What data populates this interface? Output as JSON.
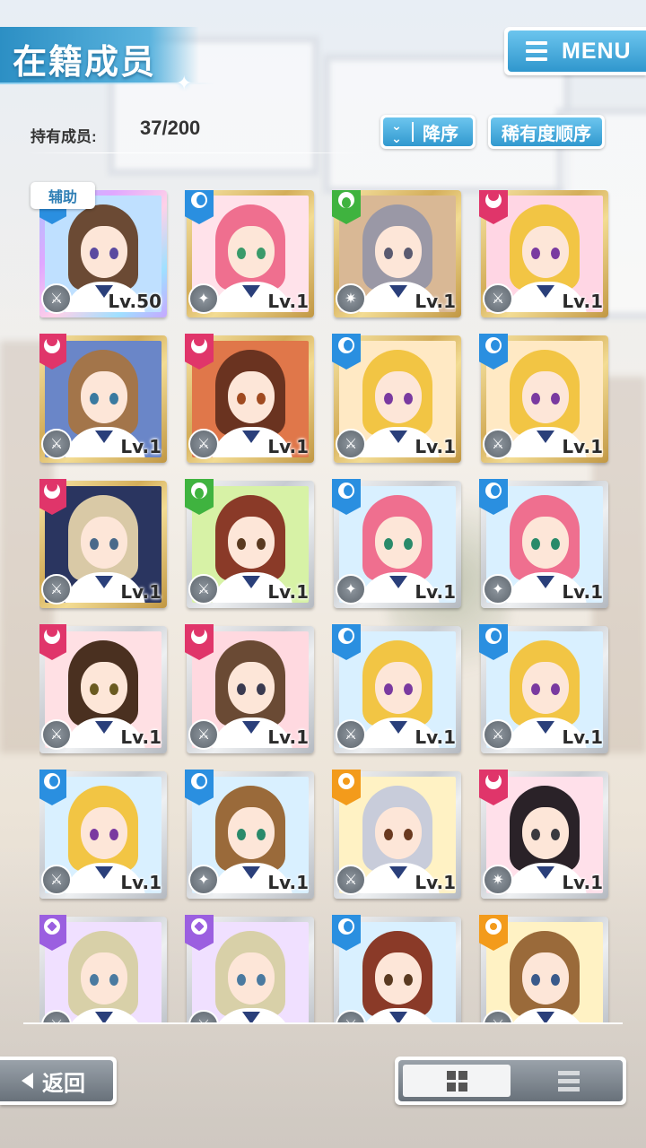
{
  "header": {
    "title": "在籍成员",
    "menu_label": "MENU"
  },
  "members": {
    "count_label": "持有成员:",
    "count_value": "37/200"
  },
  "sort": {
    "order_label": "降序",
    "mode_label": "稀有度顺序"
  },
  "support_tag": "辅助",
  "cards": [
    {
      "frame": "rainbow",
      "attr": "blue",
      "role": "⚔",
      "level": "Lv.50",
      "hair": "#6b4a34",
      "eye": "#5b4aa0",
      "bg": "#bfe0ff"
    },
    {
      "frame": "gold",
      "attr": "blue",
      "role": "✦",
      "level": "Lv.1",
      "hair": "#ef6f8f",
      "eye": "#3a9a6a",
      "bg": "#ffe2ea"
    },
    {
      "frame": "gold",
      "attr": "green",
      "role": "✷",
      "level": "Lv.1",
      "hair": "#9a98a6",
      "eye": "#5a5a70",
      "bg": "#d9b895"
    },
    {
      "frame": "gold",
      "attr": "red",
      "role": "⚔",
      "level": "Lv.1",
      "hair": "#f2c544",
      "eye": "#7a3aa0",
      "bg": "#ffd6e4"
    },
    {
      "frame": "gold",
      "attr": "red",
      "role": "⚔",
      "level": "Lv.1",
      "hair": "#a3754a",
      "eye": "#3a7aa0",
      "bg": "#6a86c8"
    },
    {
      "frame": "gold",
      "attr": "red",
      "role": "⚔",
      "level": "Lv.1",
      "hair": "#6a3320",
      "eye": "#a04a20",
      "bg": "#e0774a"
    },
    {
      "frame": "gold",
      "attr": "blue",
      "role": "⚔",
      "level": "Lv.1",
      "hair": "#f2c544",
      "eye": "#7a3aa0",
      "bg": "#ffe9c4"
    },
    {
      "frame": "gold",
      "attr": "blue",
      "role": "⚔",
      "level": "Lv.1",
      "hair": "#f2c544",
      "eye": "#7a3aa0",
      "bg": "#ffe9c4"
    },
    {
      "frame": "gold",
      "attr": "red",
      "role": "⚔",
      "level": "Lv.1",
      "hair": "#d9c9a6",
      "eye": "#4a6a8a",
      "bg": "#2a3560"
    },
    {
      "frame": "silver",
      "attr": "green",
      "role": "⚔",
      "level": "Lv.1",
      "hair": "#8a3a28",
      "eye": "#5a3a20",
      "bg": "#d7f2a6"
    },
    {
      "frame": "silver",
      "attr": "blue",
      "role": "✦",
      "level": "Lv.1",
      "hair": "#ef6f8f",
      "eye": "#2a8a6a",
      "bg": "#d9f0ff"
    },
    {
      "frame": "silver",
      "attr": "blue",
      "role": "✦",
      "level": "Lv.1",
      "hair": "#ef6f8f",
      "eye": "#2a8a6a",
      "bg": "#d9f0ff"
    },
    {
      "frame": "silver",
      "attr": "red",
      "role": "⚔",
      "level": "Lv.1",
      "hair": "#4a3020",
      "eye": "#6a5a20",
      "bg": "#ffe0e4"
    },
    {
      "frame": "silver",
      "attr": "red",
      "role": "⚔",
      "level": "Lv.1",
      "hair": "#6a4a34",
      "eye": "#3a3a50",
      "bg": "#ffd9e0"
    },
    {
      "frame": "silver",
      "attr": "blue",
      "role": "⚔",
      "level": "Lv.1",
      "hair": "#f2c544",
      "eye": "#7a3aa0",
      "bg": "#d9f0ff"
    },
    {
      "frame": "silver",
      "attr": "blue",
      "role": "⚔",
      "level": "Lv.1",
      "hair": "#f2c544",
      "eye": "#7a3aa0",
      "bg": "#d9f0ff"
    },
    {
      "frame": "silver",
      "attr": "blue",
      "role": "⚔",
      "level": "Lv.1",
      "hair": "#f2c544",
      "eye": "#7a3aa0",
      "bg": "#d9f0ff"
    },
    {
      "frame": "silver",
      "attr": "blue",
      "role": "✦",
      "level": "Lv.1",
      "hair": "#9a6a3a",
      "eye": "#2a8a6a",
      "bg": "#d9f0ff"
    },
    {
      "frame": "silver",
      "attr": "orange",
      "role": "⚔",
      "level": "Lv.1",
      "hair": "#c8ccda",
      "eye": "#6a3a20",
      "bg": "#fff2c4"
    },
    {
      "frame": "silver",
      "attr": "red",
      "role": "✷",
      "level": "Lv.1",
      "hair": "#2a2228",
      "eye": "#3a3a40",
      "bg": "#ffe0ea"
    },
    {
      "frame": "silver",
      "attr": "purple",
      "role": "⚔",
      "level": "",
      "hair": "#d8d0a8",
      "eye": "#4a7aa0",
      "bg": "#f0e0ff"
    },
    {
      "frame": "silver",
      "attr": "purple",
      "role": "⚔",
      "level": "",
      "hair": "#d8d0a8",
      "eye": "#4a7aa0",
      "bg": "#f0e0ff"
    },
    {
      "frame": "silver",
      "attr": "blue",
      "role": "⚔",
      "level": "",
      "hair": "#8a3a28",
      "eye": "#5a3a20",
      "bg": "#d9f0ff"
    },
    {
      "frame": "silver",
      "attr": "orange",
      "role": "⚔",
      "level": "",
      "hair": "#9a6a3a",
      "eye": "#3a5a8a",
      "bg": "#fff2c4"
    }
  ],
  "footer": {
    "back_label": "返回"
  }
}
